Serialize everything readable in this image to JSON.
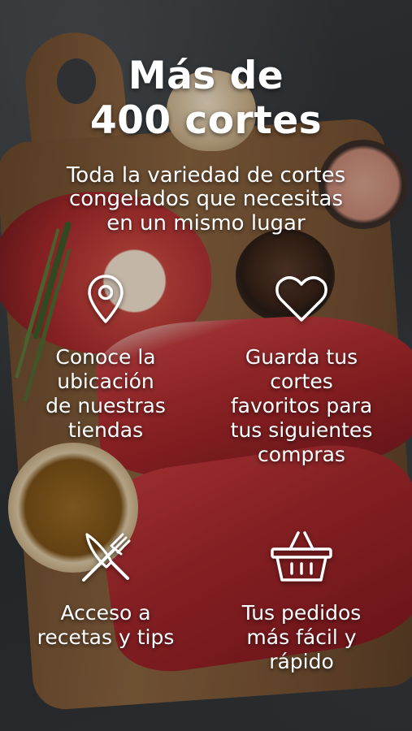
{
  "hero": {
    "title_line1": "Más de",
    "title_line2": "400 cortes",
    "subtitle_line1": "Toda la variedad de cortes",
    "subtitle_line2": "congelados que necesitas",
    "subtitle_line3": "en un mismo lugar"
  },
  "features": [
    {
      "icon": "location-pin-icon",
      "lines": [
        "Conoce la",
        "ubicación",
        "de nuestras",
        "tiendas"
      ]
    },
    {
      "icon": "heart-icon",
      "lines": [
        "Guarda tus",
        "cortes",
        "favoritos para",
        "tus siguientes",
        "compras"
      ]
    },
    {
      "icon": "fork-knife-icon",
      "lines": [
        "Acceso a",
        "recetas y tips"
      ]
    },
    {
      "icon": "shopping-basket-icon",
      "lines": [
        "Tus pedidos",
        "más fácil y",
        "rápido"
      ]
    }
  ],
  "colors": {
    "text": "#ffffff",
    "background": "#2f3234",
    "board": "#7a5535",
    "meat": "#a42629"
  }
}
